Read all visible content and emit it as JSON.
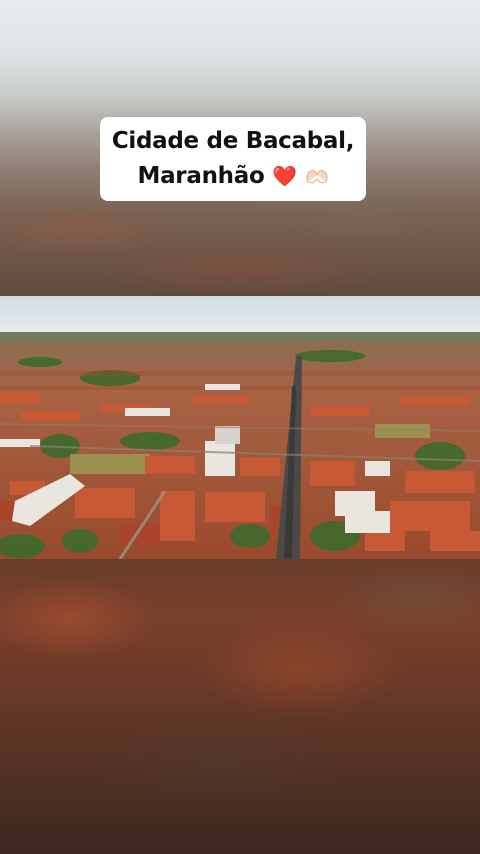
{
  "caption": {
    "line1": "Cidade de Bacabal,",
    "line2": "Maranhão",
    "heart_emoji": "❤️",
    "hands_emoji": "heart-hands-icon"
  },
  "photo": {
    "subject": "aerial-city-view-icon"
  },
  "colors": {
    "caption_bg": "#ffffff",
    "caption_text": "#111111",
    "heart": "#e0162b",
    "roof_terracotta": "#b5522e",
    "sky": "#dbe4ea"
  }
}
